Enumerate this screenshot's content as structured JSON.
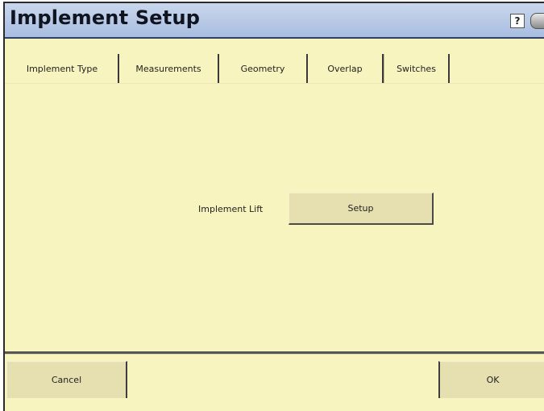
{
  "window": {
    "title": "Implement Setup",
    "help_glyph": "?",
    "icons": [
      "help-icon",
      "camera-icon"
    ]
  },
  "tabs": [
    {
      "label": "Implement Type",
      "active": false
    },
    {
      "label": "Measurements",
      "active": false
    },
    {
      "label": "Geometry",
      "active": false
    },
    {
      "label": "Overlap",
      "active": false
    },
    {
      "label": "Switches",
      "active": true
    }
  ],
  "switches": {
    "implement_lift_label": "Implement Lift",
    "setup_button": "Setup"
  },
  "footer": {
    "cancel_label": "Cancel",
    "ok_label": "OK"
  },
  "colors": {
    "background": "#f8f4bf",
    "titlebar": "#b6c8e6",
    "button": "#e6e0b0"
  }
}
